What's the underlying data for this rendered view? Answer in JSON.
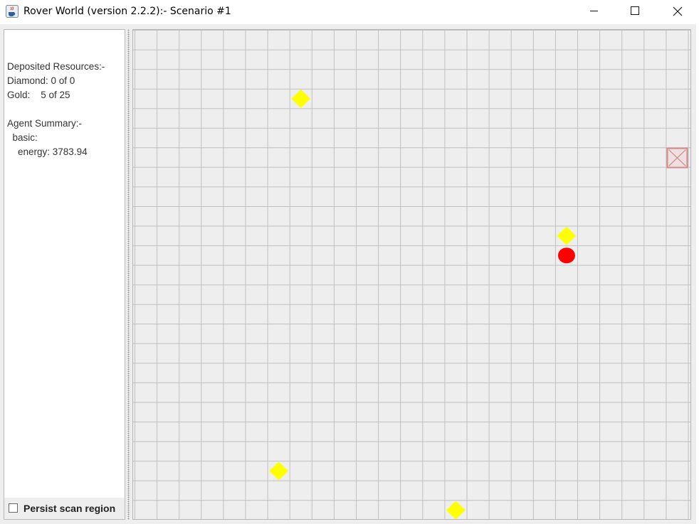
{
  "window": {
    "title": "Rover World (version 2.2.2):- Scenario #1",
    "app_icon": "java-coffee-cup-icon",
    "controls": [
      "minimize-icon",
      "maximize-icon",
      "close-icon"
    ]
  },
  "info_panel": {
    "text": "Deposited Resources:-\nDiamond: 0 of 0\nGold:    5 of 25\n\nAgent Summary:-\n  basic:\n    energy: 3783.94"
  },
  "persist": {
    "label": "Persist scan region",
    "checked": false
  },
  "world": {
    "cols": 25,
    "rows": 25,
    "colors": {
      "background": "#eeeeee",
      "grid_line": "#c0c0c0",
      "gold": "#ffff00",
      "rover": "#ff0000",
      "base": "#d08a8a"
    },
    "gold": [
      {
        "col": 7,
        "row": 3
      },
      {
        "col": 19,
        "row": 10
      },
      {
        "col": 6,
        "row": 22
      },
      {
        "col": 14,
        "row": 24
      }
    ],
    "rover": {
      "col": 19,
      "row": 11
    },
    "base": {
      "col": 24,
      "row": 6
    }
  }
}
